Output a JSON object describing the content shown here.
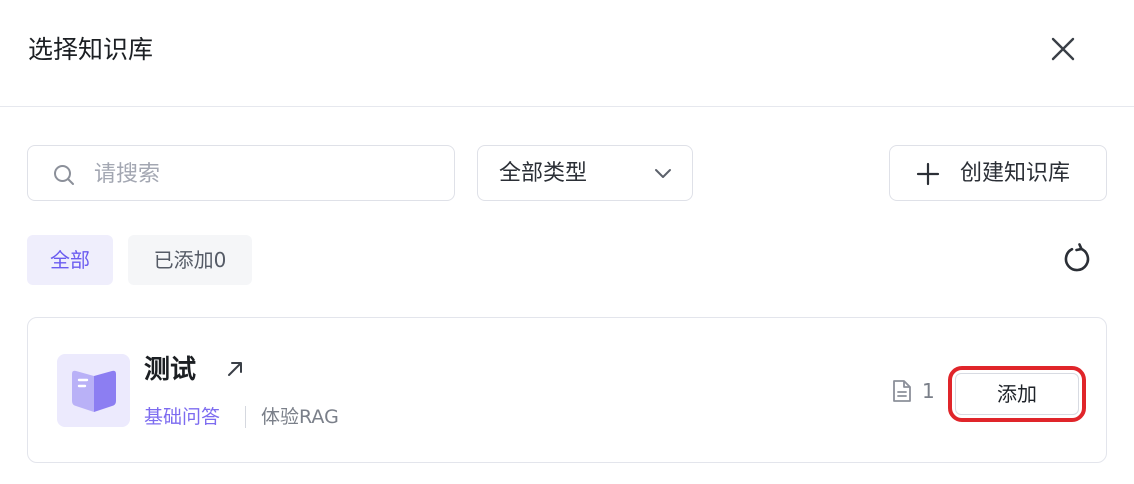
{
  "dialog": {
    "title": "选择知识库"
  },
  "search": {
    "placeholder": "请搜索",
    "value": ""
  },
  "type_select": {
    "selected": "全部类型"
  },
  "create_button": {
    "label": "创建知识库"
  },
  "tabs": [
    {
      "label": "全部",
      "active": true
    },
    {
      "label": "已添加0",
      "active": false
    }
  ],
  "knowledge_bases": [
    {
      "name": "测试",
      "tag": "基础问答",
      "subtitle": "体验RAG",
      "doc_count": "1",
      "add_label": "添加"
    }
  ],
  "icons": {
    "close": "close-icon",
    "search": "search-icon",
    "dropdown": "chevron-down-icon",
    "create": "plus-icon",
    "refresh": "refresh-icon",
    "external": "external-link-icon",
    "document": "document-icon",
    "book": "book-icon"
  },
  "colors": {
    "accent": "#6b5cf0",
    "accent_bg": "#efeefc",
    "highlight": "#e0252a"
  }
}
